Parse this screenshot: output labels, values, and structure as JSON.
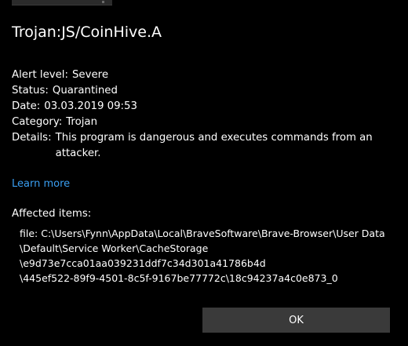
{
  "dialog": {
    "title": "Trojan:JS/CoinHive.A",
    "alert_level": {
      "label": "Alert level:",
      "value": "Severe"
    },
    "status": {
      "label": "Status:",
      "value": "Quarantined"
    },
    "date": {
      "label": "Date:",
      "value": "03.03.2019 09:53"
    },
    "category": {
      "label": "Category:",
      "value": "Trojan"
    },
    "details": {
      "label": "Details:",
      "value": "This program is dangerous and executes commands from an attacker."
    },
    "learn_more": "Learn more",
    "affected_heading": "Affected items:",
    "affected_lines": [
      "file: C:\\Users\\Fynn\\AppData\\Local\\BraveSoftware\\Brave-Browser\\User Data",
      "\\Default\\Service Worker\\CacheStorage",
      "\\e9d73e7cca01aa039231ddf7c34d301a41786b4d",
      "\\445ef522-89f9-4501-8c5f-9167be77772c\\18c94237a4c0e873_0"
    ],
    "ok_label": "OK"
  },
  "colors": {
    "background": "#000000",
    "text": "#ffffff",
    "link": "#3a9ef0",
    "button": "#3a3a3a"
  }
}
